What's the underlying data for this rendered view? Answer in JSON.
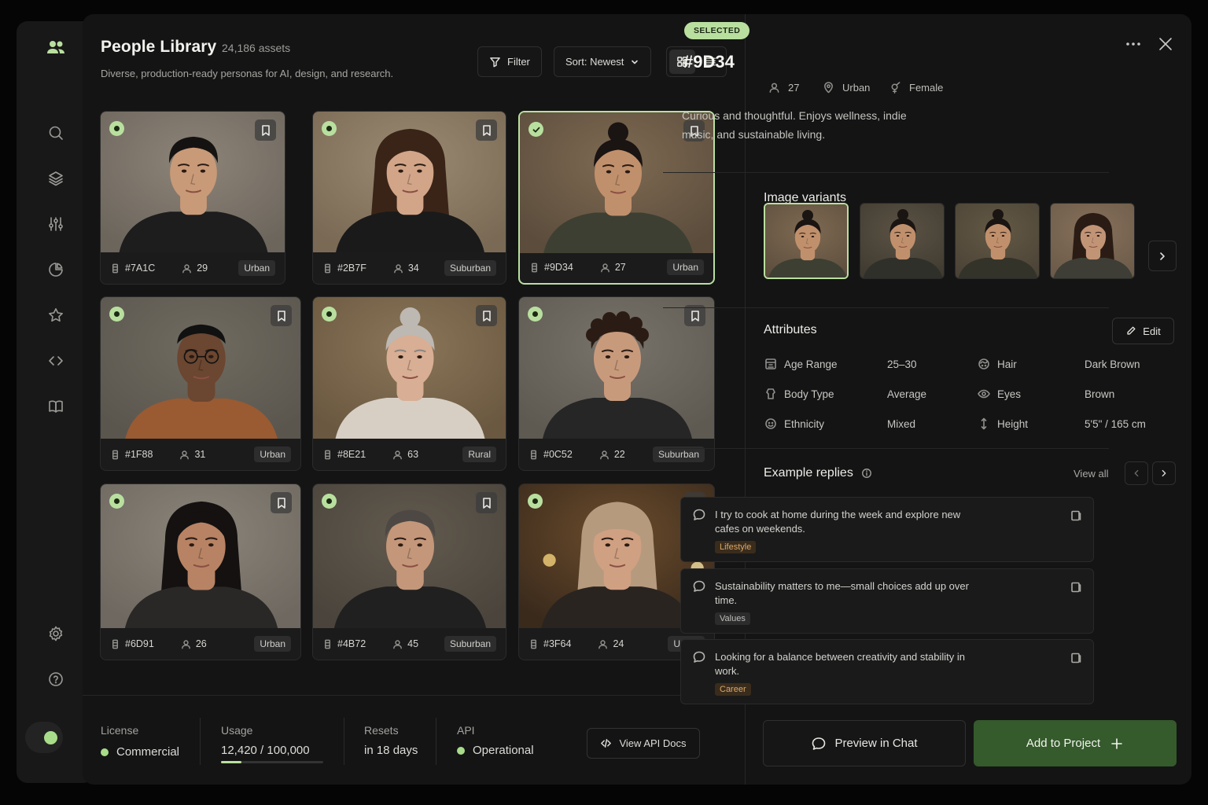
{
  "library": {
    "title": "People Library",
    "count": "24,186 assets",
    "subtitle": "Diverse, production-ready personas for AI, design, and research.",
    "filter_label": "Filter",
    "sort_label": "Sort: Newest"
  },
  "cards": [
    {
      "id": "#7A1C",
      "age": "29",
      "tag": "Urban"
    },
    {
      "id": "#2B7F",
      "age": "34",
      "tag": "Suburban"
    },
    {
      "id": "#9D34",
      "age": "27",
      "tag": "Urban"
    },
    {
      "id": "#1F88",
      "age": "31",
      "tag": "Urban"
    },
    {
      "id": "#8E21",
      "age": "63",
      "tag": "Rural"
    },
    {
      "id": "#0C52",
      "age": "22",
      "tag": "Suburban"
    },
    {
      "id": "#6D91",
      "age": "26",
      "tag": "Urban"
    },
    {
      "id": "#4B72",
      "age": "45",
      "tag": "Suburban"
    },
    {
      "id": "#3F64",
      "age": "24",
      "tag": "Urban"
    }
  ],
  "stats": {
    "license_label": "License",
    "license_value": "Commercial",
    "usage_label": "Usage",
    "usage_value": "12,420 / 100,000",
    "usage_fraction": 0.1242,
    "resets_label": "Resets",
    "resets_value": "in 18 days",
    "api_label": "API",
    "api_value": "Operational",
    "api_docs_label": "View API Docs"
  },
  "detail": {
    "badge": "SELECTED",
    "id": "#9D34",
    "age": "27",
    "location": "Urban",
    "gender": "Female",
    "description": "Curious and thoughtful. Enjoys wellness, indie music, and sustainable living.",
    "variants_title": "Image variants",
    "attributes_title": "Attributes",
    "edit_label": "Edit",
    "attributes": [
      {
        "name": "Age Range",
        "value": "25–30",
        "icon": "age-range-icon"
      },
      {
        "name": "Hair",
        "value": "Dark Brown",
        "icon": "hair-icon"
      },
      {
        "name": "Body Type",
        "value": "Average",
        "icon": "body-type-icon"
      },
      {
        "name": "Eyes",
        "value": "Brown",
        "icon": "eye-icon"
      },
      {
        "name": "Ethnicity",
        "value": "Mixed",
        "icon": "ethnicity-icon"
      },
      {
        "name": "Height",
        "value": "5'5\" / 165 cm",
        "icon": "height-icon"
      }
    ],
    "replies_title": "Example replies",
    "view_all": "View all",
    "replies": [
      {
        "text": "I try to cook at home during the week and explore new cafes on weekends.",
        "tag": "Lifestyle",
        "tag_color": "#d9a86a"
      },
      {
        "text": "Sustainability matters to me—small choices add up over time.",
        "tag": "Values",
        "tag_color": "#bdbdb9"
      },
      {
        "text": "Looking for a balance between creativity and stability in work.",
        "tag": "Career",
        "tag_color": "#d9a86a"
      }
    ],
    "preview_label": "Preview in Chat",
    "add_label": "Add to Project"
  },
  "colors": {
    "accent": "#b9df9f",
    "primary_button": "#355a2c",
    "panel": "#141414"
  }
}
